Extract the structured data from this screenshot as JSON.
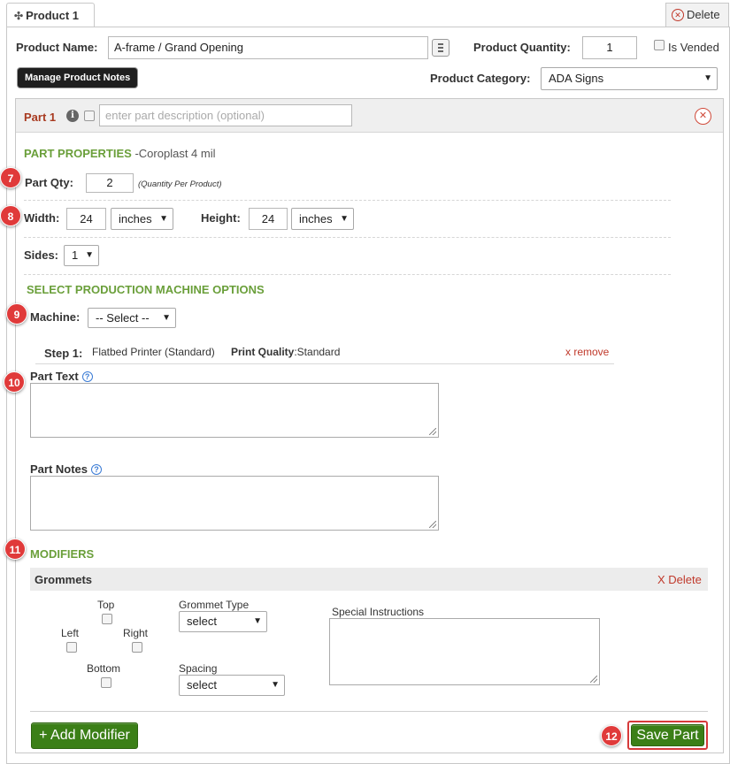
{
  "tab": {
    "title": "Product 1",
    "delete_label": "Delete"
  },
  "product": {
    "name_label": "Product Name:",
    "name_value": "A-frame / Grand Opening",
    "quantity_label": "Product Quantity:",
    "quantity_value": "1",
    "vended_label": "Is Vended",
    "manage_notes_label": "Manage Product Notes",
    "category_label": "Product Category:",
    "category_value": "ADA Signs"
  },
  "part": {
    "title": "Part 1",
    "description_placeholder": "enter part description (optional)",
    "properties_heading": "PART PROPERTIES",
    "material": "-Coroplast 4 mil",
    "qty_label": "Part Qty:",
    "qty_value": "2",
    "qty_hint": "(Quantity Per Product)",
    "width_label": "Width:",
    "width_value": "24",
    "width_unit": "inches",
    "height_label": "Height:",
    "height_value": "24",
    "height_unit": "inches",
    "sides_label": "Sides:",
    "sides_value": "1"
  },
  "machine": {
    "heading": "SELECT PRODUCTION MACHINE OPTIONS",
    "label": "Machine:",
    "select_value": "-- Select --",
    "step_label": "Step 1:",
    "step_machine": "Flatbed Printer (Standard)",
    "quality_label": "Print Quality",
    "quality_value": ":Standard",
    "remove_label": "x remove"
  },
  "text_fields": {
    "part_text_label": "Part Text",
    "part_notes_label": "Part Notes"
  },
  "modifiers": {
    "heading": "MODIFIERS",
    "grommets_title": "Grommets",
    "delete_label": "X Delete",
    "top": "Top",
    "left": "Left",
    "right": "Right",
    "bottom": "Bottom",
    "grommet_type_label": "Grommet Type",
    "grommet_type_value": "select",
    "spacing_label": "Spacing",
    "spacing_value": "select",
    "special_instructions_label": "Special Instructions"
  },
  "actions": {
    "add_modifier_label": "+ Add Modifier",
    "save_part_label": "Save Part"
  },
  "badges": {
    "b7": "7",
    "b8": "8",
    "b9": "9",
    "b10": "10",
    "b11": "11",
    "b12": "12"
  },
  "colors": {
    "accent_green": "#6a9f3a",
    "button_green": "#3b7f17",
    "badge_red": "#e03a3a",
    "link_red": "#c0392b"
  }
}
